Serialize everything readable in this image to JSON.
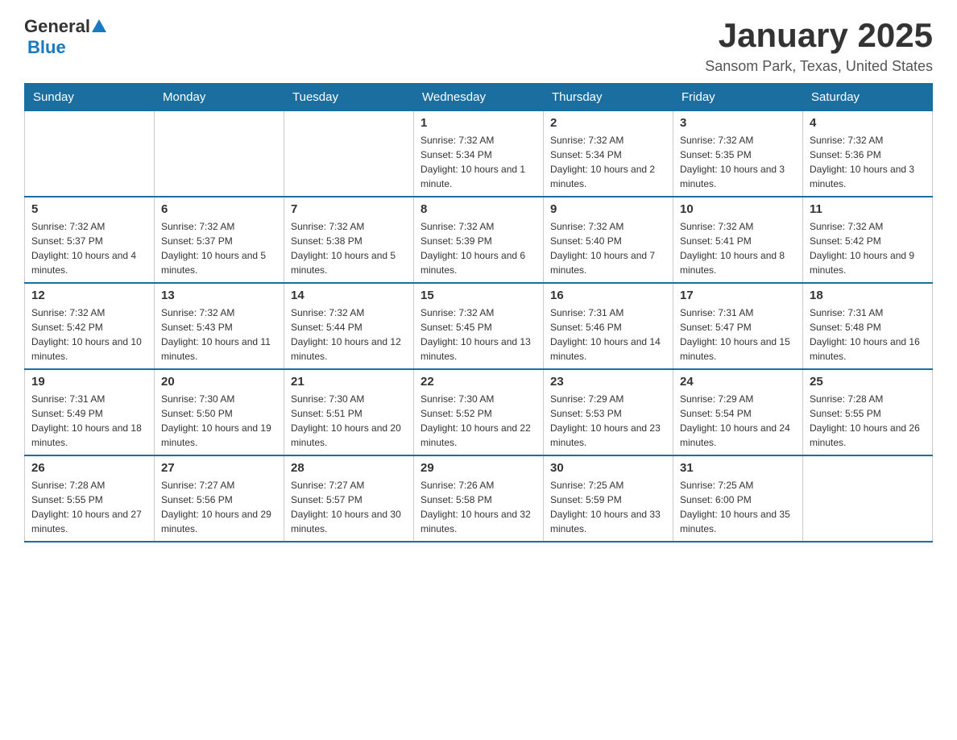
{
  "header": {
    "logo": {
      "general_text": "General",
      "blue_text": "Blue"
    },
    "title": "January 2025",
    "location": "Sansom Park, Texas, United States"
  },
  "weekdays": [
    "Sunday",
    "Monday",
    "Tuesday",
    "Wednesday",
    "Thursday",
    "Friday",
    "Saturday"
  ],
  "weeks": [
    [
      {
        "day": "",
        "info": ""
      },
      {
        "day": "",
        "info": ""
      },
      {
        "day": "",
        "info": ""
      },
      {
        "day": "1",
        "info": "Sunrise: 7:32 AM\nSunset: 5:34 PM\nDaylight: 10 hours and 1 minute."
      },
      {
        "day": "2",
        "info": "Sunrise: 7:32 AM\nSunset: 5:34 PM\nDaylight: 10 hours and 2 minutes."
      },
      {
        "day": "3",
        "info": "Sunrise: 7:32 AM\nSunset: 5:35 PM\nDaylight: 10 hours and 3 minutes."
      },
      {
        "day": "4",
        "info": "Sunrise: 7:32 AM\nSunset: 5:36 PM\nDaylight: 10 hours and 3 minutes."
      }
    ],
    [
      {
        "day": "5",
        "info": "Sunrise: 7:32 AM\nSunset: 5:37 PM\nDaylight: 10 hours and 4 minutes."
      },
      {
        "day": "6",
        "info": "Sunrise: 7:32 AM\nSunset: 5:37 PM\nDaylight: 10 hours and 5 minutes."
      },
      {
        "day": "7",
        "info": "Sunrise: 7:32 AM\nSunset: 5:38 PM\nDaylight: 10 hours and 5 minutes."
      },
      {
        "day": "8",
        "info": "Sunrise: 7:32 AM\nSunset: 5:39 PM\nDaylight: 10 hours and 6 minutes."
      },
      {
        "day": "9",
        "info": "Sunrise: 7:32 AM\nSunset: 5:40 PM\nDaylight: 10 hours and 7 minutes."
      },
      {
        "day": "10",
        "info": "Sunrise: 7:32 AM\nSunset: 5:41 PM\nDaylight: 10 hours and 8 minutes."
      },
      {
        "day": "11",
        "info": "Sunrise: 7:32 AM\nSunset: 5:42 PM\nDaylight: 10 hours and 9 minutes."
      }
    ],
    [
      {
        "day": "12",
        "info": "Sunrise: 7:32 AM\nSunset: 5:42 PM\nDaylight: 10 hours and 10 minutes."
      },
      {
        "day": "13",
        "info": "Sunrise: 7:32 AM\nSunset: 5:43 PM\nDaylight: 10 hours and 11 minutes."
      },
      {
        "day": "14",
        "info": "Sunrise: 7:32 AM\nSunset: 5:44 PM\nDaylight: 10 hours and 12 minutes."
      },
      {
        "day": "15",
        "info": "Sunrise: 7:32 AM\nSunset: 5:45 PM\nDaylight: 10 hours and 13 minutes."
      },
      {
        "day": "16",
        "info": "Sunrise: 7:31 AM\nSunset: 5:46 PM\nDaylight: 10 hours and 14 minutes."
      },
      {
        "day": "17",
        "info": "Sunrise: 7:31 AM\nSunset: 5:47 PM\nDaylight: 10 hours and 15 minutes."
      },
      {
        "day": "18",
        "info": "Sunrise: 7:31 AM\nSunset: 5:48 PM\nDaylight: 10 hours and 16 minutes."
      }
    ],
    [
      {
        "day": "19",
        "info": "Sunrise: 7:31 AM\nSunset: 5:49 PM\nDaylight: 10 hours and 18 minutes."
      },
      {
        "day": "20",
        "info": "Sunrise: 7:30 AM\nSunset: 5:50 PM\nDaylight: 10 hours and 19 minutes."
      },
      {
        "day": "21",
        "info": "Sunrise: 7:30 AM\nSunset: 5:51 PM\nDaylight: 10 hours and 20 minutes."
      },
      {
        "day": "22",
        "info": "Sunrise: 7:30 AM\nSunset: 5:52 PM\nDaylight: 10 hours and 22 minutes."
      },
      {
        "day": "23",
        "info": "Sunrise: 7:29 AM\nSunset: 5:53 PM\nDaylight: 10 hours and 23 minutes."
      },
      {
        "day": "24",
        "info": "Sunrise: 7:29 AM\nSunset: 5:54 PM\nDaylight: 10 hours and 24 minutes."
      },
      {
        "day": "25",
        "info": "Sunrise: 7:28 AM\nSunset: 5:55 PM\nDaylight: 10 hours and 26 minutes."
      }
    ],
    [
      {
        "day": "26",
        "info": "Sunrise: 7:28 AM\nSunset: 5:55 PM\nDaylight: 10 hours and 27 minutes."
      },
      {
        "day": "27",
        "info": "Sunrise: 7:27 AM\nSunset: 5:56 PM\nDaylight: 10 hours and 29 minutes."
      },
      {
        "day": "28",
        "info": "Sunrise: 7:27 AM\nSunset: 5:57 PM\nDaylight: 10 hours and 30 minutes."
      },
      {
        "day": "29",
        "info": "Sunrise: 7:26 AM\nSunset: 5:58 PM\nDaylight: 10 hours and 32 minutes."
      },
      {
        "day": "30",
        "info": "Sunrise: 7:25 AM\nSunset: 5:59 PM\nDaylight: 10 hours and 33 minutes."
      },
      {
        "day": "31",
        "info": "Sunrise: 7:25 AM\nSunset: 6:00 PM\nDaylight: 10 hours and 35 minutes."
      },
      {
        "day": "",
        "info": ""
      }
    ]
  ]
}
